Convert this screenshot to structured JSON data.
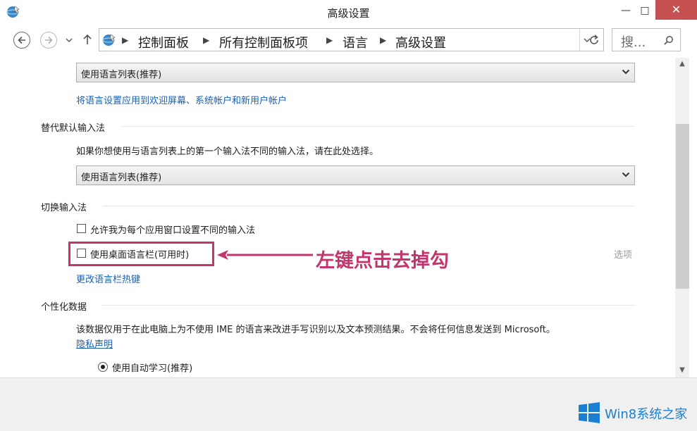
{
  "window": {
    "title": "高级设置",
    "minimize_glyph": "—",
    "maximize_glyph": "□",
    "close_glyph": "✕"
  },
  "nav": {
    "breadcrumbs": [
      "控制面板",
      "所有控制面板项",
      "语言",
      "高级设置"
    ],
    "search_placeholder": "搜...",
    "icons": {
      "back": "back-arrow-icon",
      "forward": "forward-arrow-icon",
      "recent": "chevron-down-icon",
      "up": "up-arrow-icon",
      "location": "control-panel-icon",
      "history": "chevron-down-icon",
      "refresh": "refresh-icon",
      "search": "search-icon"
    }
  },
  "content": {
    "display_language_dropdown": "使用语言列表(推荐)",
    "apply_link": "将语言设置应用到欢迎屏幕、系统帐户和新用户帐户",
    "override_input": {
      "title": "替代默认输入法",
      "description": "如果你想使用与语言列表上的第一个输入法不同的输入法，请在此处选择。",
      "dropdown": "使用语言列表(推荐)"
    },
    "switch_input": {
      "title": "切换输入法",
      "per_app_checkbox": "允许我为每个应用窗口设置不同的输入法",
      "desktop_bar_checkbox": "使用桌面语言栏(可用时)",
      "options_link": "选项",
      "hotkeys_link": "更改语言栏热键"
    },
    "personalization": {
      "title": "个性化数据",
      "description": "该数据仅用于在此电脑上为不使用 IME 的语言来改进手写识别以及文本预测结果。不会将任何信息发送到 Microsoft。",
      "privacy_link": "隐私声明",
      "radio_auto_learn": "使用自动学习(推荐)"
    }
  },
  "annotation": {
    "text": "左键点击去掉勾",
    "color": "#c3356c"
  },
  "watermark": {
    "text": "Win8系统之家"
  },
  "colors": {
    "link": "#1a5fb4",
    "close": "#c75050",
    "accent": "#c3356c"
  }
}
